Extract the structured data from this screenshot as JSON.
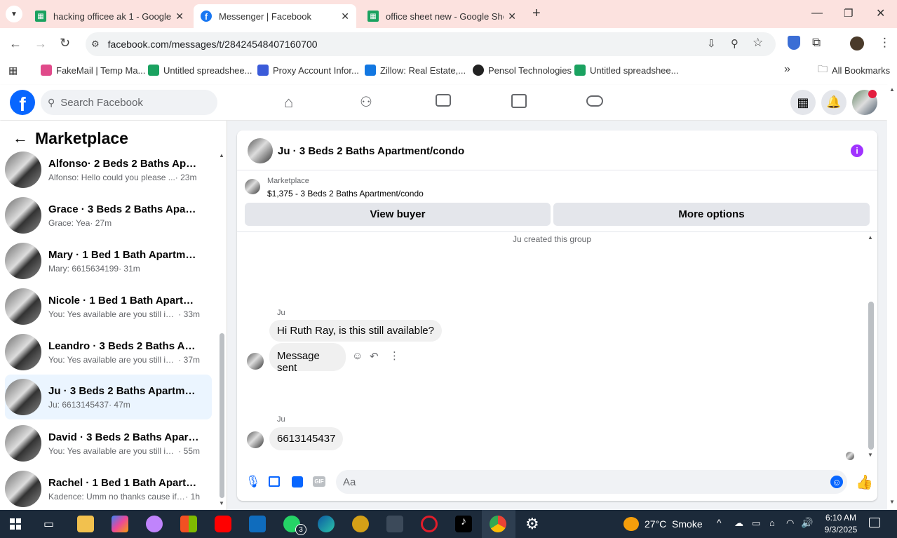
{
  "browser": {
    "tabs": [
      {
        "title": "hacking officee ak 1 - Google Sh",
        "active": false
      },
      {
        "title": "Messenger | Facebook",
        "active": true
      },
      {
        "title": "office sheet new - Google Shee",
        "active": false
      }
    ],
    "new_tab": "+",
    "url": "facebook.com/messages/t/28424548407160700",
    "bookmarks": [
      {
        "label": "FakeMail | Temp Ma...",
        "color": "#e04a8a"
      },
      {
        "label": "Untitled spreadshee...",
        "color": "#1aa260"
      },
      {
        "label": "Proxy Account Infor...",
        "color": "#3b5bd9"
      },
      {
        "label": "Zillow: Real Estate,...",
        "color": "#1277e1"
      },
      {
        "label": "Pensol Technologies",
        "color": "#222222"
      },
      {
        "label": "Untitled spreadshee...",
        "color": "#1aa260"
      }
    ],
    "more_bookmarks": "»",
    "all_bookmarks": "All Bookmarks"
  },
  "facebook": {
    "logo": "f",
    "search_placeholder": "Search Facebook",
    "notif_icon": "bell-icon"
  },
  "sidebar": {
    "title": "Marketplace",
    "conversations": [
      {
        "name": "Alfonso· 2 Beds 2 Baths Apartm...",
        "preview": "Alfonso: Hello could you please ...",
        "time": "· 23m",
        "selected": false
      },
      {
        "name": "Grace · 3 Beds 2 Baths Apartme...",
        "preview": "Grace: Yea",
        "time": "· 27m",
        "selected": false
      },
      {
        "name": "Mary · 1 Bed 1 Bath Apartment/...",
        "preview": "Mary: 6615634199",
        "time": "· 31m",
        "selected": false
      },
      {
        "name": "Nicole · 1 Bed 1 Bath Apartment...",
        "preview": "You: Yes available are you still int...",
        "time": "· 33m",
        "selected": false
      },
      {
        "name": "Leandro · 3 Beds 2 Baths Apart...",
        "preview": "You: Yes available are you still int...",
        "time": "· 37m",
        "selected": false
      },
      {
        "name": "Ju · 3 Beds 2 Baths Apartment/c...",
        "preview": "Ju: 6613145437",
        "time": "· 47m",
        "selected": true
      },
      {
        "name": "David · 3 Beds 2 Baths Apartme...",
        "preview": "You: Yes available are you still int...",
        "time": "· 55m",
        "selected": false
      },
      {
        "name": "Rachel · 1 Bed 1 Bath Apartment...",
        "preview": "Kadence: Umm no thanks cause if ...",
        "time": "· 1h",
        "selected": false
      }
    ]
  },
  "chat": {
    "title": "Ju · 3 Beds 2 Baths Apartment/condo",
    "listing_source": "Marketplace",
    "listing": "$1,375 - 3 Beds 2 Baths Apartment/condo",
    "view_buyer": "View buyer",
    "more_options": "More options",
    "system_msg": "Ju created this group",
    "msg1_sender": "Ju",
    "msg1": "Hi Ruth Ray, is this still available?",
    "msg2": "Message sent",
    "msg3_sender": "Ju",
    "msg3": "6613145437",
    "input_placeholder": "Aa",
    "gif_label": "GIF"
  },
  "taskbar": {
    "weather": "27°C  Smoke",
    "time": "6:10 AM",
    "date": "9/3/2025",
    "whatsapp_badge": "3"
  }
}
